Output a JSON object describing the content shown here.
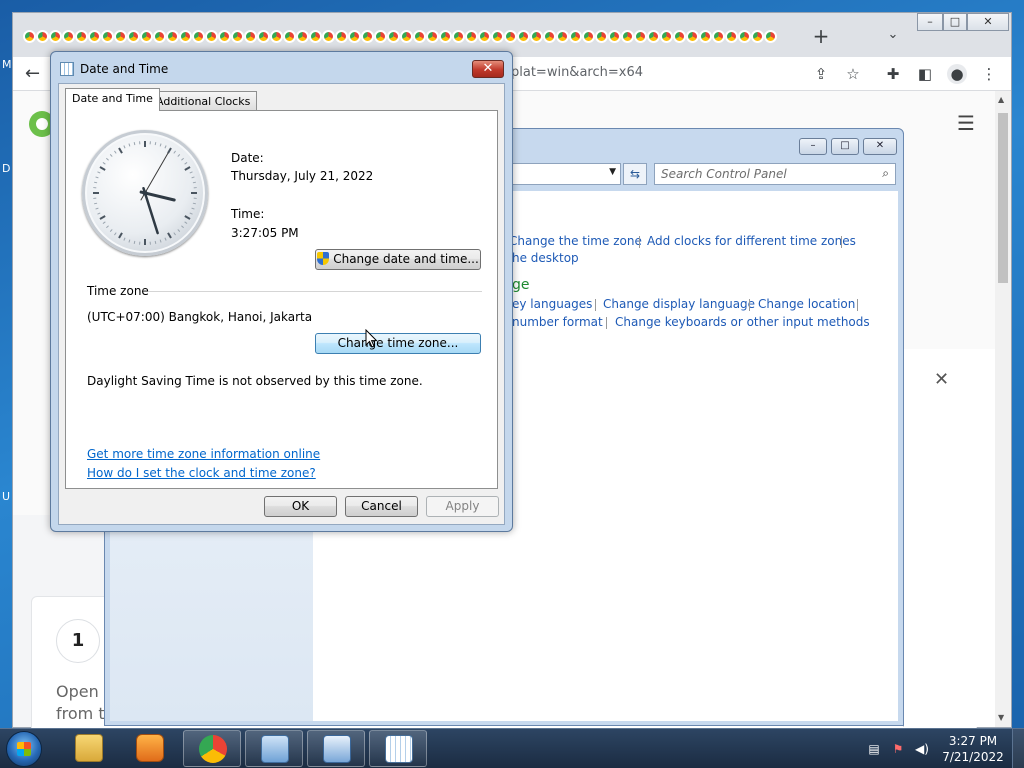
{
  "desktop": {
    "letters": [
      "M",
      "D",
      "U"
    ]
  },
  "browser": {
    "omnibox_text": "plat=win&arch=x64",
    "new_tab": "+",
    "tab_search": "⌄",
    "window_controls": {
      "minimize": "–",
      "maximize": "□",
      "close": "✕"
    },
    "page": {
      "step_number": "1",
      "step_text": "Open the\nfrom the",
      "overlay_close": "✕"
    }
  },
  "control_panel": {
    "search_placeholder": "Search Control Panel",
    "links": {
      "change_time_zone": "Change the time zone",
      "add_clocks": "Add clocks for different time zones",
      "desktop": "he desktop",
      "languages": "ey languages",
      "change_display_language": "Change display language",
      "change_location": "Change location",
      "number_format": "number format",
      "change_keyboards": "Change keyboards or other input methods"
    },
    "heading_fragment": "ge"
  },
  "dialog": {
    "title": "Date and Time",
    "close": "✕",
    "tabs": {
      "date_and_time": "Date and Time",
      "additional_clocks": "Additional Clocks"
    },
    "date_label": "Date:",
    "date_value": "Thursday, July 21, 2022",
    "time_label": "Time:",
    "time_value": "3:27:05 PM",
    "change_date_time_button": "Change date and time...",
    "time_zone_heading": "Time zone",
    "time_zone_value": "(UTC+07:00) Bangkok, Hanoi, Jakarta",
    "change_time_zone_button": "Change time zone...",
    "dst_note": "Daylight Saving Time is not observed by this time zone.",
    "link_more_info": "Get more time zone information online",
    "link_how_to": "How do I set the clock and time zone?",
    "ok_button": "OK",
    "cancel_button": "Cancel",
    "apply_button": "Apply",
    "clock": {
      "hours": 3,
      "minutes": 27,
      "seconds": 5
    }
  },
  "taskbar": {
    "time": "3:27 PM",
    "date": "7/21/2022"
  },
  "colors": {
    "link": "#0066cc",
    "cp_link": "#1e5ab6",
    "accent": "#3c7fb1"
  }
}
